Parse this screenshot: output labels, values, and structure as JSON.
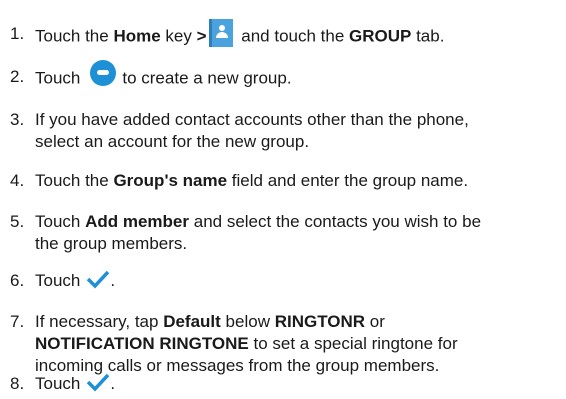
{
  "steps": [
    {
      "num": "1.",
      "a": "Touch the ",
      "b1": "Home",
      "c": " key ",
      "b2": ">",
      "d": " and touch the ",
      "b3": "GROUP",
      "e": " tab."
    },
    {
      "num": "2.",
      "a": "Touch",
      "b": "to create a new group."
    },
    {
      "num": "3.",
      "line1": "If you have added contact accounts other than the phone,",
      "line2": "select an account for the new group."
    },
    {
      "num": "4.",
      "a": "Touch the ",
      "b1": "Group's name",
      "c": " field and enter the group name."
    },
    {
      "num": "5.",
      "a": "Touch ",
      "b1": "Add member",
      "c": " and select the contacts you wish to be",
      "line2": "the group members."
    },
    {
      "num": "6.",
      "a": "Touch",
      "end": "."
    },
    {
      "num": "7.",
      "a": "If necessary, tap ",
      "b1": "Default",
      "c": " below ",
      "b2": "RINGTONR",
      "d": " or",
      "b3": "NOTIFICATION RINGTONE",
      "e": " to set a special ringtone for",
      "line3": "incoming calls or messages from the group members."
    },
    {
      "num": "8.",
      "a": "Touch",
      "end": "."
    }
  ],
  "icons": {
    "contacts": "contacts-app-icon",
    "group_add": "add-group-icon",
    "check": "checkmark-icon"
  }
}
